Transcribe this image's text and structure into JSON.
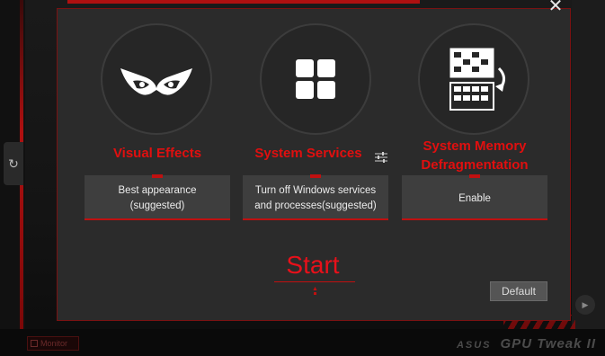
{
  "background": {
    "monitor_label": "Monitor",
    "brand_asus": "ASUS",
    "brand_name": "GPU Tweak II",
    "side_tab_glyph": "↻",
    "play_glyph": "▶"
  },
  "dialog": {
    "close_glyph": "✕",
    "options": [
      {
        "title": "Visual Effects",
        "value_line1": "Best appearance",
        "value_line2": "(suggested)",
        "icon": "owl-eyes-icon"
      },
      {
        "title": "System Services",
        "value_line1": "Turn off Windows services",
        "value_line2": "and processes(suggested)",
        "icon": "four-squares-icon"
      },
      {
        "title_line1": "System Memory",
        "title_line2": "Defragmentation",
        "value": "Enable",
        "icon": "memory-defrag-icon"
      }
    ],
    "start_label": "Start",
    "default_label": "Default"
  },
  "colors": {
    "accent_red": "#e00f0f",
    "dialog_bg": "#2b2b2b",
    "option_box_bg": "#3e3e3e"
  }
}
